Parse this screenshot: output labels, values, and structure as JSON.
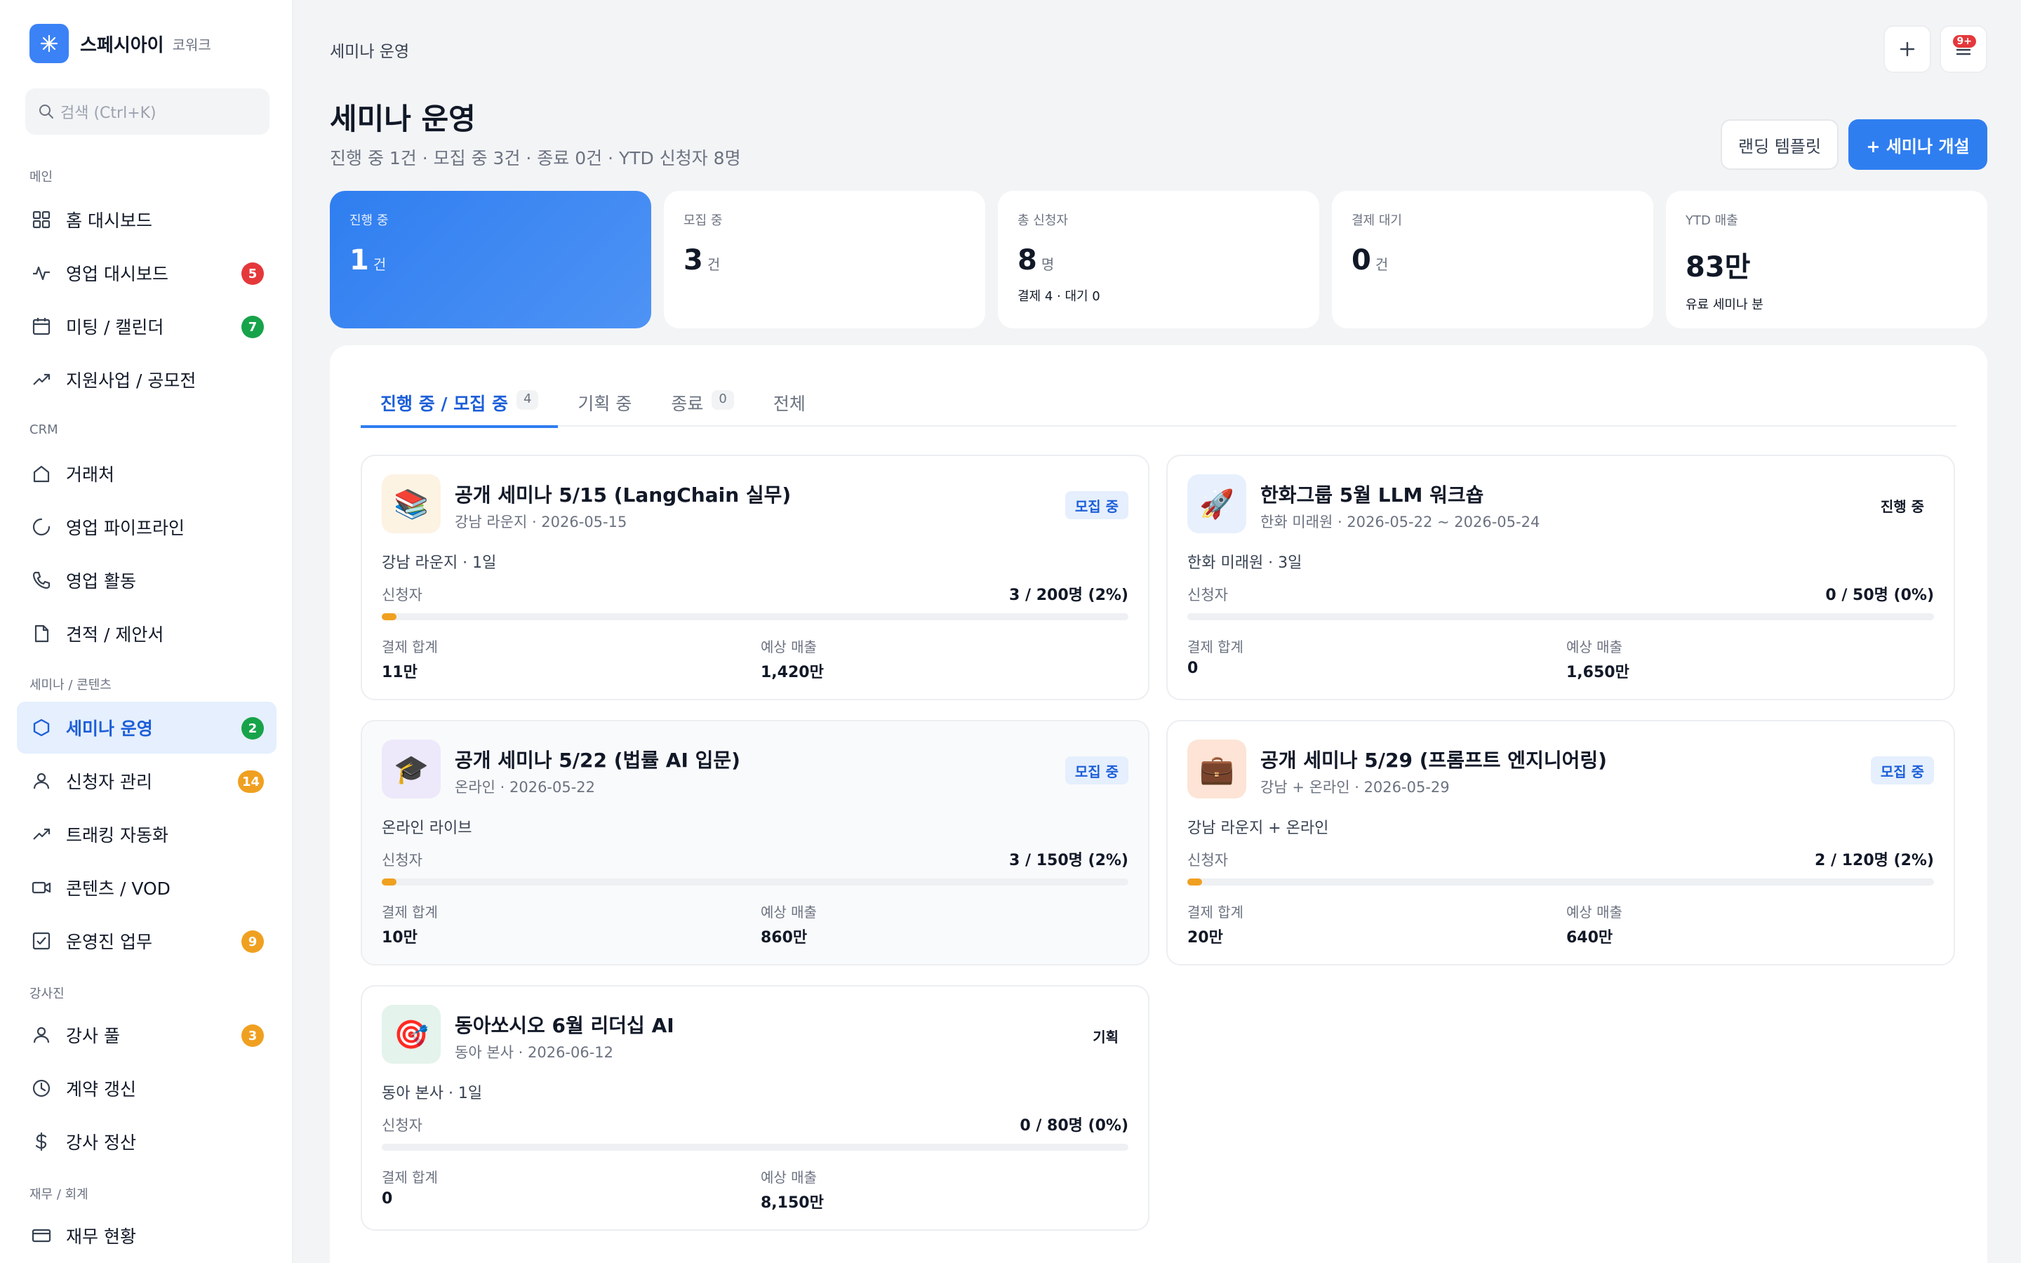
{
  "brand": {
    "name": "스페시아이",
    "sub": "코워크",
    "logo_icon": "sparkle-icon",
    "accent": "#3b82f6"
  },
  "search": {
    "placeholder": "검색 (Ctrl+K)"
  },
  "sidebar": {
    "sections": [
      {
        "title": "메인",
        "items": [
          {
            "label": "홈 대시보드",
            "icon": "grid-icon"
          },
          {
            "label": "영업 대시보드",
            "icon": "activity-icon",
            "badge": "5",
            "badge_color": "red"
          },
          {
            "label": "미팅 / 캘린더",
            "icon": "calendar-icon",
            "badge": "7",
            "badge_color": "green"
          },
          {
            "label": "지원사업 / 공모전",
            "icon": "trending-icon"
          }
        ]
      },
      {
        "title": "CRM",
        "items": [
          {
            "label": "거래처",
            "icon": "home-icon"
          },
          {
            "label": "영업 파이프라인",
            "icon": "loader-icon"
          },
          {
            "label": "영업 활동",
            "icon": "phone-icon"
          },
          {
            "label": "견적 / 제안서",
            "icon": "file-icon"
          }
        ]
      },
      {
        "title": "세미나 / 콘텐츠",
        "items": [
          {
            "label": "세미나 운영",
            "icon": "hexagon-icon",
            "badge": "2",
            "badge_color": "green",
            "active": true
          },
          {
            "label": "신청자 관리",
            "icon": "user-icon",
            "badge": "14",
            "badge_color": "orange"
          },
          {
            "label": "트래킹 자동화",
            "icon": "trending-icon"
          },
          {
            "label": "콘텐츠 / VOD",
            "icon": "video-icon"
          },
          {
            "label": "운영진 업무",
            "icon": "checkbox-icon",
            "badge": "9",
            "badge_color": "orange"
          }
        ]
      },
      {
        "title": "강사진",
        "items": [
          {
            "label": "강사 풀",
            "icon": "user-icon",
            "badge": "3",
            "badge_color": "orange"
          },
          {
            "label": "계약 갱신",
            "icon": "clock-icon"
          },
          {
            "label": "강사 정산",
            "icon": "dollar-icon"
          }
        ]
      },
      {
        "title": "재무 / 회계",
        "items": [
          {
            "label": "재무 현황",
            "icon": "card-icon"
          }
        ]
      }
    ]
  },
  "header": {
    "breadcrumb": "세미나 운영",
    "notif_badge": "9+"
  },
  "page": {
    "title": "세미나 운영",
    "subtitle": "진행 중 1건 · 모집 중 3건 · 종료 0건 · YTD 신청자 8명",
    "btn_template": "랜딩 템플릿",
    "btn_create": "+ 세미나 개설"
  },
  "stats": [
    {
      "label": "진행 중",
      "value": "1",
      "unit": "건",
      "note": "",
      "highlight": true
    },
    {
      "label": "모집 중",
      "value": "3",
      "unit": "건",
      "note": ""
    },
    {
      "label": "총 신청자",
      "value": "8",
      "unit": "명",
      "note": "결제 4 · 대기 0"
    },
    {
      "label": "결제 대기",
      "value": "0",
      "unit": "건",
      "note": ""
    },
    {
      "label": "YTD 매출",
      "value": "83만",
      "unit": "",
      "note": "유료 세미나 분"
    }
  ],
  "tabs": [
    {
      "label": "진행 중 / 모집 중",
      "count": "4",
      "active": true
    },
    {
      "label": "기획 중",
      "count": ""
    },
    {
      "label": "종료",
      "count": "0"
    },
    {
      "label": "전체",
      "count": ""
    }
  ],
  "labels": {
    "applicants": "신청자",
    "pay_total": "결제 합계",
    "expected": "예상 매출"
  },
  "seminars": [
    {
      "title": "공개 세미나 5/15 (LangChain 실무)",
      "sub": "강남 라운지 · 2026-05-15",
      "status": "모집 중",
      "status_style": "blue",
      "location": "강남 라운지 · 1일",
      "applicants": "3 / 200명 (2%)",
      "progress": 0.02,
      "pay_total": "11만",
      "expected": "1,420만",
      "emoji": "📚",
      "bg": "#fdf3e3",
      "tint": false
    },
    {
      "title": "한화그룹 5월 LLM 워크숍",
      "sub": "한화 미래원 · 2026-05-22 ~ 2026-05-24",
      "status": "진행 중",
      "status_style": "plain",
      "location": "한화 미래원 · 3일",
      "applicants": "0 / 50명 (0%)",
      "progress": 0,
      "pay_total": "0",
      "expected": "1,650만",
      "emoji": "🚀",
      "bg": "#e8f0fd",
      "tint": false
    },
    {
      "title": "공개 세미나 5/22 (법률 AI 입문)",
      "sub": "온라인 · 2026-05-22",
      "status": "모집 중",
      "status_style": "blue",
      "location": "온라인 라이브",
      "applicants": "3 / 150명 (2%)",
      "progress": 0.02,
      "pay_total": "10만",
      "expected": "860만",
      "emoji": "🎓",
      "bg": "#ede9fb",
      "tint": true
    },
    {
      "title": "공개 세미나 5/29 (프롬프트 엔지니어링)",
      "sub": "강남 + 온라인 · 2026-05-29",
      "status": "모집 중",
      "status_style": "blue",
      "location": "강남 라운지 + 온라인",
      "applicants": "2 / 120명 (2%)",
      "progress": 0.02,
      "pay_total": "20만",
      "expected": "640만",
      "emoji": "💼",
      "bg": "#fde4d6",
      "tint": false
    },
    {
      "title": "동아쏘시오 6월 리더십 AI",
      "sub": "동아 본사 · 2026-06-12",
      "status": "기획",
      "status_style": "plain",
      "location": "동아 본사 · 1일",
      "applicants": "0 / 80명 (0%)",
      "progress": 0,
      "pay_total": "0",
      "expected": "8,150만",
      "emoji": "🎯",
      "bg": "#e4f3ec",
      "tint": false
    }
  ]
}
